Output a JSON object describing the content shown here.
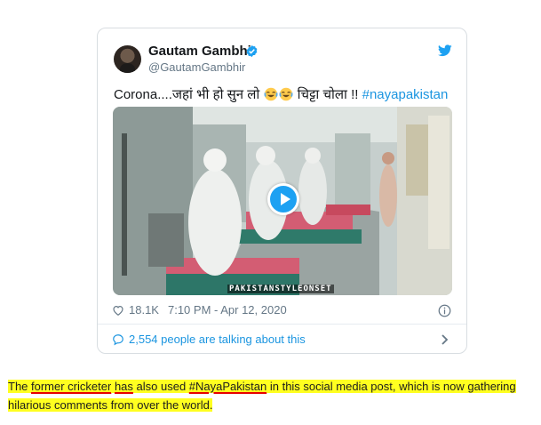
{
  "tweet": {
    "display_name": "Gautam Gambhir",
    "handle": "@GautamGambhir",
    "text_part1": "Corona....जहां भी हो सुन लो",
    "text_part2": " चिट्टा चोला !! ",
    "hashtag": "#nayapakistan",
    "emojis": [
      "face-with-tears-of-joy",
      "face-with-tears-of-joy"
    ],
    "video_watermark": "PAKISTANSTYLEONSET",
    "like_count": "18.1K",
    "timestamp": "7:10 PM - Apr 12, 2020",
    "talking_about": "2,554 people are talking about this",
    "accent_color": "#1da1f2",
    "icons": [
      "verified-badge",
      "twitter-bird",
      "play",
      "heart",
      "info",
      "speech-bubble",
      "chevron-right"
    ]
  },
  "caption": {
    "t1": "The ",
    "t2": "former cricketer",
    "t3": " ",
    "t4": "has",
    "t5": " also used ",
    "t6": "#NayaPakistan",
    "t7": " in this social media post, which is now gathering hilarious comments from over the world.",
    "highlight_color": "#ffff20",
    "underline_color": "#e60000"
  }
}
